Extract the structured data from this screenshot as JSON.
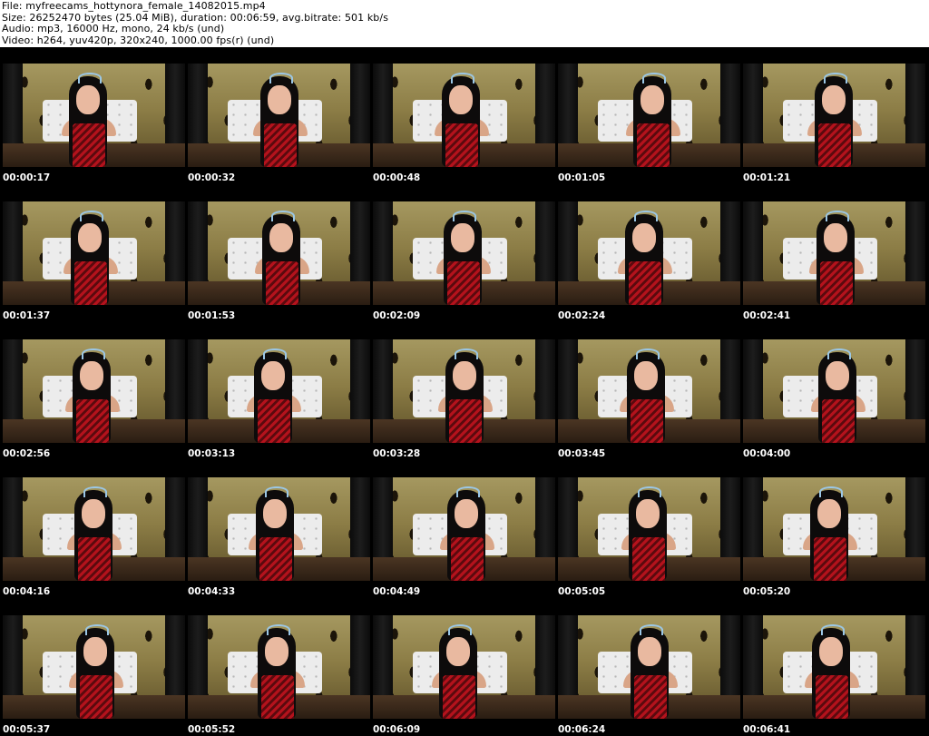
{
  "header": {
    "file": "File: myfreecams_hottynora_female_14082015.mp4",
    "size": "Size: 26252470 bytes (25.04 MiB), duration: 00:06:59, avg.bitrate: 501 kb/s",
    "audio": "Audio: mp3, 16000 Hz, mono, 24 kb/s (und)",
    "video": "Video: h264, yuv420p, 320x240, 1000.00 fps(r) (und)"
  },
  "timestamps": [
    "00:00:17",
    "00:00:32",
    "00:00:48",
    "00:01:05",
    "00:01:21",
    "00:01:37",
    "00:01:53",
    "00:02:09",
    "00:02:24",
    "00:02:41",
    "00:02:56",
    "00:03:13",
    "00:03:28",
    "00:03:45",
    "00:04:00",
    "00:04:16",
    "00:04:33",
    "00:04:49",
    "00:05:05",
    "00:05:20",
    "00:05:37",
    "00:05:52",
    "00:06:09",
    "00:06:24",
    "00:06:41"
  ]
}
